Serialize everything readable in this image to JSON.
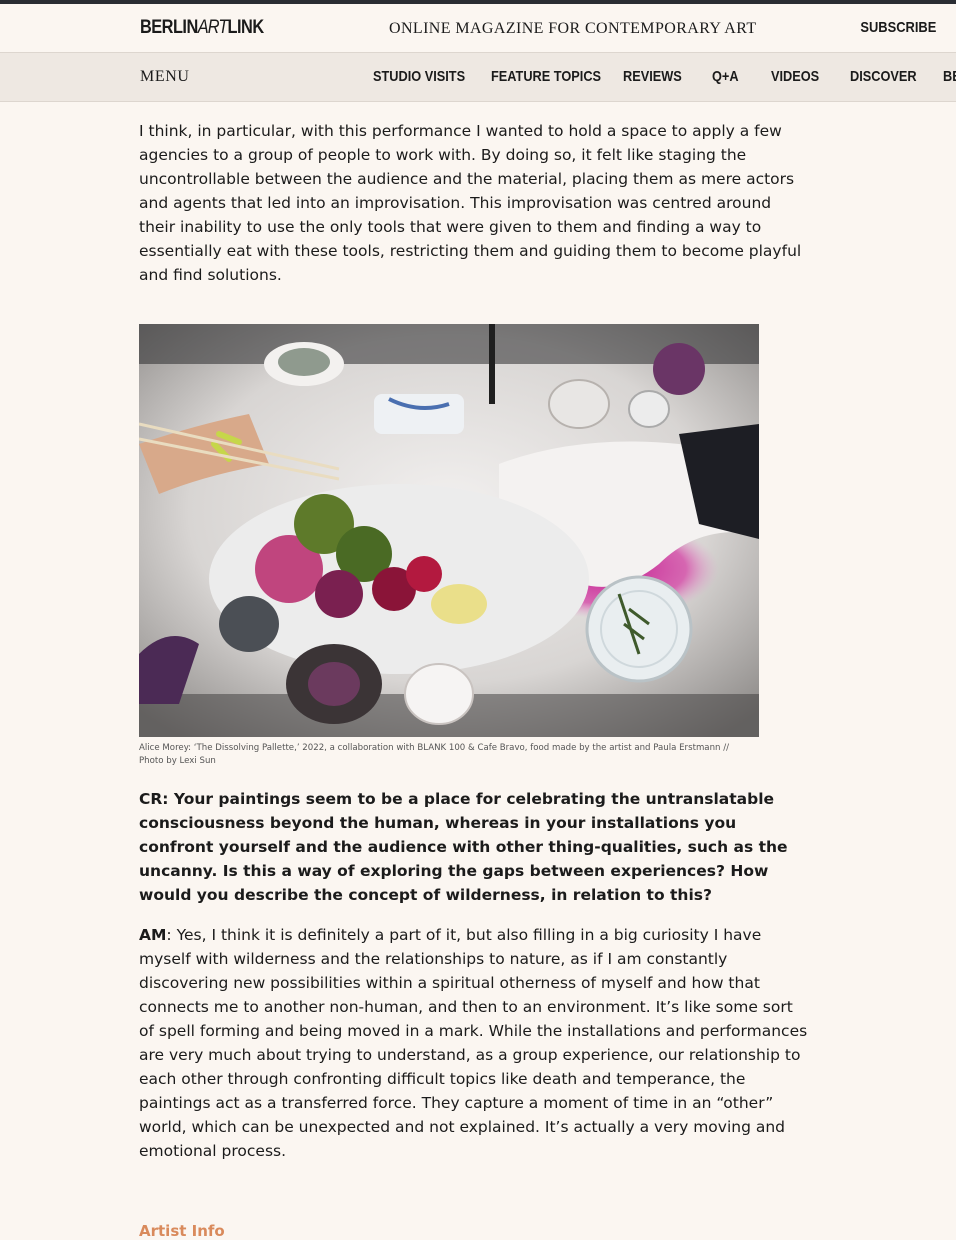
{
  "header": {
    "logo_left": "BERLIN",
    "logo_mid": "ART",
    "logo_right": "LINK",
    "tagline": "ONLINE MAGAZINE FOR CONTEMPORARY ART",
    "subscribe": "Subscribe"
  },
  "nav": {
    "menu": "MENU",
    "items": [
      "Studio Visits",
      "Feature Topics",
      "Reviews",
      "Q+A",
      "Videos",
      "Discover",
      "Be"
    ]
  },
  "article": {
    "para1": "I think, in particular, with this performance I wanted to hold a space to apply a few agencies to a group of people to work with. By doing so, it felt like staging the uncontrollable between the audience and the material, placing them as mere actors and agents that led into an improvisation. This improvisation was centred around their inability to use the only tools that were given to them and finding a way to essentially eat with these tools, restricting them and guiding them to become playful and find solutions.",
    "caption": "Alice Morey: ‘The Dissolving Pallette,’ 2022, a collaboration with BLANK 100 & Cafe Bravo, food made by the artist and Paula Erstmann // Photo by Lexi Sun",
    "question": "CR: Your paintings seem to be a place for celebrating the untranslatable consciousness beyond the human, whereas in your installations you confront yourself and the audience with other thing-qualities, such as the uncanny. Is this a way of exploring the gaps between experiences? How would you describe the concept of wilderness, in relation to this?",
    "answer_speaker": "AM",
    "answer": ": Yes, I think it is definitely a part of it, but also filling in a big curiosity I have myself with wilderness and the relationships to nature, as if I am constantly discovering new possibilities within a spiritual otherness of myself and how that connects me to another non-human, and then to an environment. It’s like some sort of spell forming and being moved in a mark. While the installations and performances are very much about trying to understand, as a group experience, our relationship to each other through confronting difficult topics like death and temperance, the paintings act as a transferred force. They capture a moment of time in an “other” world, which can be unexpected and not explained. It’s actually a very moving and emotional process.",
    "artist_info": "Artist Info"
  },
  "colors": {
    "background": "#fbf6f1",
    "navbar": "#eee8e2",
    "accent_link": "#d98a5c"
  }
}
